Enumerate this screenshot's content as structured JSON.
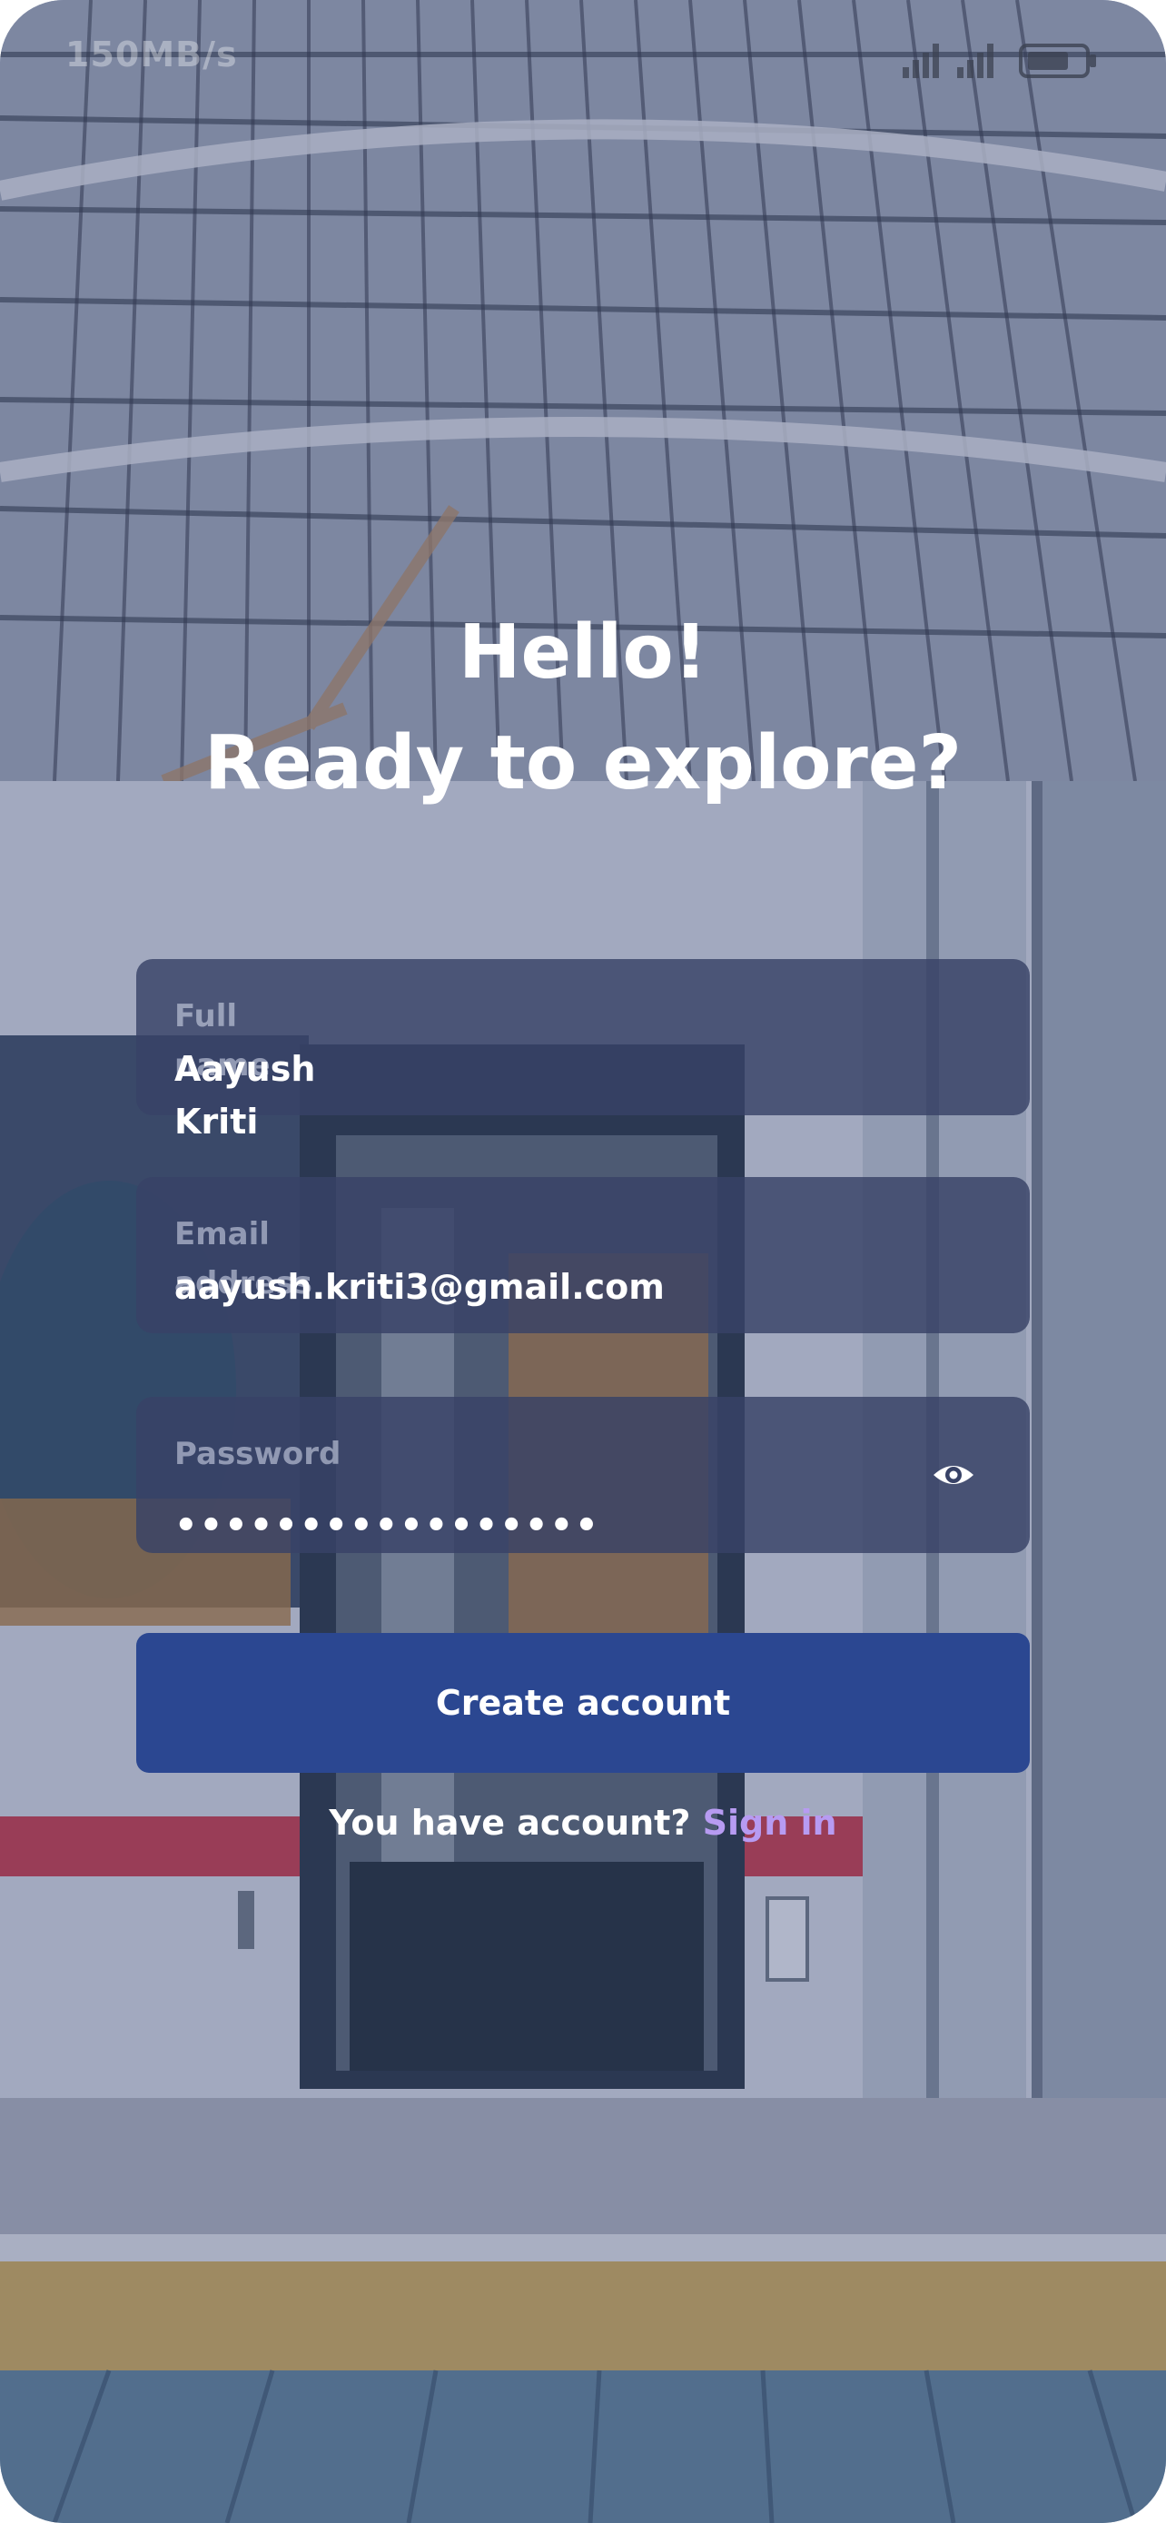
{
  "status_bar": {
    "speed": "150MB/s",
    "icons": [
      "signal-icon",
      "signal-icon",
      "battery-icon"
    ]
  },
  "heading": {
    "line1": "Hello!",
    "line2": "Ready to explore?"
  },
  "form": {
    "name": {
      "label": "Full name",
      "value": "Aayush Kriti"
    },
    "email": {
      "label": "Email address",
      "value": "aayush.kriti3@gmail.com"
    },
    "password": {
      "label": "Password",
      "value": "•••••••••••••••••",
      "icon": "eye-icon"
    }
  },
  "create_button": {
    "label": "Create account"
  },
  "footer": {
    "prompt": "You have account?",
    "link": "Sign in"
  },
  "colors": {
    "button": "#2b4791",
    "link": "#b79bf2",
    "field_bg": "#384266",
    "overlay": "#3a4876"
  }
}
